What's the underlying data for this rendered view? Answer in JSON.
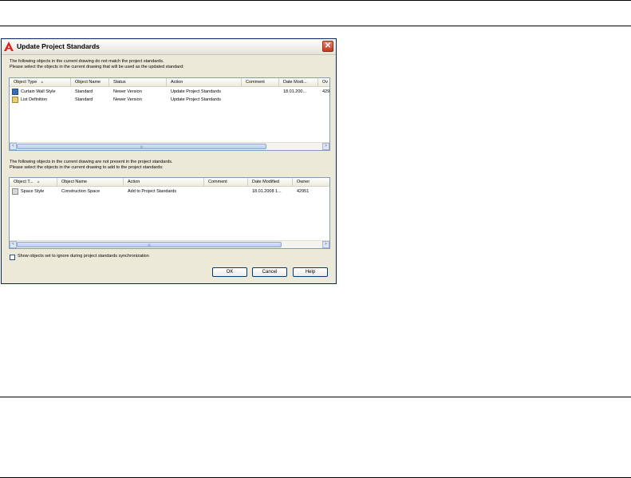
{
  "dialog": {
    "title": "Update Project Standards",
    "close_glyph": "✕",
    "app_icon": "autocad-logo-icon"
  },
  "top_section": {
    "info_line1": "The following objects in the current drawing do not match the project standards.",
    "info_line2": "Please select the objects in the current drawing that will be used as the updated standard:",
    "columns": [
      "Object Type",
      "Object Name",
      "Status",
      "Action",
      "Comment",
      "Date Modi...",
      "Ov"
    ],
    "rows": [
      {
        "icon": "curtain-wall-style-icon",
        "type": "Curtain Wall Style",
        "name": "Standard",
        "status": "Newer Version",
        "action": "Update Project Standards",
        "comment": "",
        "date": "18.01.200...",
        "owner": "429"
      },
      {
        "icon": "list-definition-icon",
        "type": "List Definition",
        "name": "Standard",
        "status": "Newer Version",
        "action": "Update Project Standards",
        "comment": "",
        "date": "",
        "owner": ""
      }
    ]
  },
  "bottom_section": {
    "info_line1": "The following objects in the current drawing are not present in the project standards.",
    "info_line2": "Please select the objects in the current drawing to add to the project standards:",
    "columns": [
      "Object T...",
      "Object Name",
      "Action",
      "Comment",
      "Date Modified",
      "Owner"
    ],
    "rows": [
      {
        "icon": "space-style-icon",
        "type": "Space Style",
        "name": "Construction Space",
        "action": "Add to Project Standards",
        "comment": "",
        "date": "18.01.2008 1...",
        "owner": "42951"
      }
    ]
  },
  "scroll": {
    "left": "<",
    "right": ">",
    "thumb": "|||"
  },
  "sort_glyph": "▲",
  "checkbox_label": "Show objects set to ignore during project standards synchronization",
  "buttons": {
    "ok": "OK",
    "cancel": "Cancel",
    "help": "Help"
  }
}
